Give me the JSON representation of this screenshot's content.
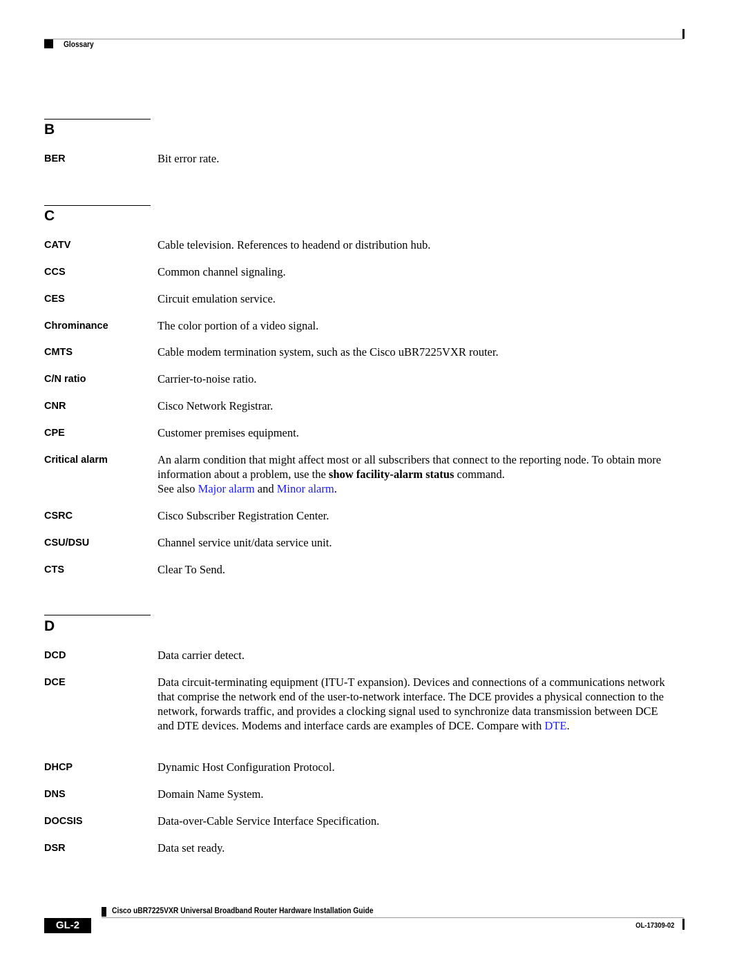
{
  "header": {
    "section": "Glossary"
  },
  "sections": [
    {
      "letter": "B",
      "entries": [
        {
          "term": "BER",
          "definition": "Bit error rate."
        }
      ]
    },
    {
      "letter": "C",
      "entries": [
        {
          "term": "CATV",
          "definition": "Cable television. References to headend or distribution hub."
        },
        {
          "term": "CCS",
          "definition": "Common channel signaling."
        },
        {
          "term": "CES",
          "definition": "Circuit emulation service."
        },
        {
          "term": "Chrominance",
          "definition": "The color portion of a video signal."
        },
        {
          "term": "CMTS",
          "definition": "Cable modem termination system, such as the Cisco uBR7225VXR router."
        },
        {
          "term": "C/N ratio",
          "definition": "Carrier-to-noise ratio."
        },
        {
          "term": "CNR",
          "definition": "Cisco Network Registrar."
        },
        {
          "term": "CPE",
          "definition": "Customer premises equipment."
        },
        {
          "term": "Critical alarm",
          "definition_parts": {
            "line1": "An alarm condition that might affect most or all subscribers that connect to the reporting node. To obtain more information about a problem, use the ",
            "command": "show facility-alarm status",
            "line1_end": " command.",
            "see_also_prefix": "See also ",
            "link1": "Major alarm",
            "and": " and ",
            "link2": "Minor alarm",
            "end": "."
          }
        },
        {
          "term": "CSRC",
          "definition": "Cisco Subscriber Registration Center."
        },
        {
          "term": "CSU/DSU",
          "definition": "Channel service unit/data service unit."
        },
        {
          "term": "CTS",
          "definition": "Clear To Send."
        }
      ]
    },
    {
      "letter": "D",
      "entries": [
        {
          "term": "DCD",
          "definition": "Data carrier detect."
        },
        {
          "term": "DCE",
          "definition_parts": {
            "text": "Data circuit-terminating equipment (ITU-T expansion). Devices and connections of a communications network that comprise the network end of the user-to-network interface. The DCE provides a physical connection to the network, forwards traffic, and provides a clocking signal used to synchronize data transmission between DCE and DTE devices. Modems and interface cards are examples of DCE. Compare with ",
            "link": "DTE",
            "end": "."
          }
        },
        {
          "term": "DHCP",
          "definition": "Dynamic Host Configuration Protocol."
        },
        {
          "term": "DNS",
          "definition": "Domain Name System."
        },
        {
          "term": "DOCSIS",
          "definition": "Data-over-Cable Service Interface Specification."
        },
        {
          "term": "DSR",
          "definition": "Data set ready."
        }
      ]
    }
  ],
  "footer": {
    "title": "Cisco uBR7225VXR Universal Broadband Router Hardware Installation Guide",
    "page": "GL-2",
    "doc_number": "OL-17309-02"
  },
  "colors": {
    "link": "#1a1aff"
  }
}
